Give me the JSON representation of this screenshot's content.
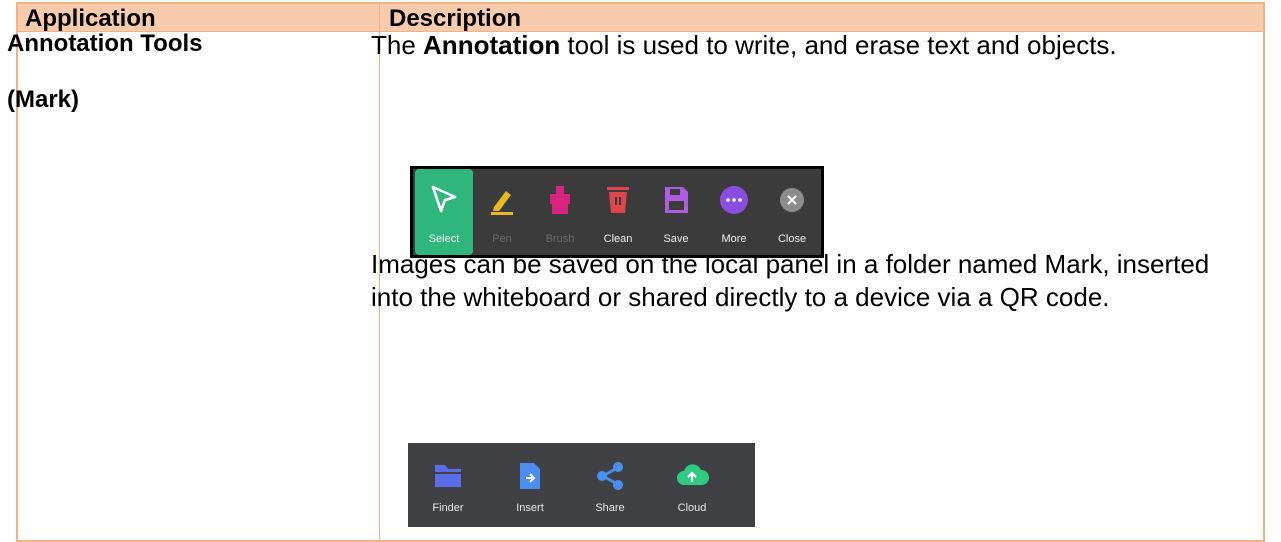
{
  "table": {
    "header": {
      "application": "Application",
      "description": "Description"
    },
    "row": {
      "application_line1": "Annotation Tools",
      "application_line2": "(Mark)",
      "desc1_pre": "The ",
      "desc1_bold": "Annotation",
      "desc1_post": " tool is used to write, and erase text and objects.",
      "desc2": "Images can be saved on the local panel in a folder named Mark, inserted into the whiteboard or shared directly to a device via a QR code."
    }
  },
  "annotation_toolbar": {
    "tools": [
      {
        "label": "Select",
        "icon": "cursor-arrow-icon",
        "active": true
      },
      {
        "label": "Pen",
        "icon": "pen-icon",
        "color": "#E8B923",
        "dim": true
      },
      {
        "label": "Brush",
        "icon": "brush-icon",
        "color": "#D6257E",
        "dim": true
      },
      {
        "label": "Clean",
        "icon": "trash-icon",
        "color": "#E0454E"
      },
      {
        "label": "Save",
        "icon": "save-icon",
        "color": "#B05CE0"
      },
      {
        "label": "More",
        "icon": "more-dots-icon",
        "color": "#8A4FE0"
      },
      {
        "label": "Close",
        "icon": "close-icon",
        "color": "#8C8C8C"
      }
    ],
    "active_color": "#2FB67C"
  },
  "save_toolbar": {
    "tools": [
      {
        "label": "Finder",
        "icon": "folder-icon",
        "color": "#5B6EE8"
      },
      {
        "label": "Insert",
        "icon": "insert-file-icon",
        "color": "#4C8EF0"
      },
      {
        "label": "Share",
        "icon": "share-icon",
        "color": "#4C8EF0"
      },
      {
        "label": "Cloud",
        "icon": "cloud-upload-icon",
        "color": "#2FCB83"
      }
    ]
  },
  "colors": {
    "table_border": "#F4B183",
    "header_fill": "#F8CBAD"
  }
}
